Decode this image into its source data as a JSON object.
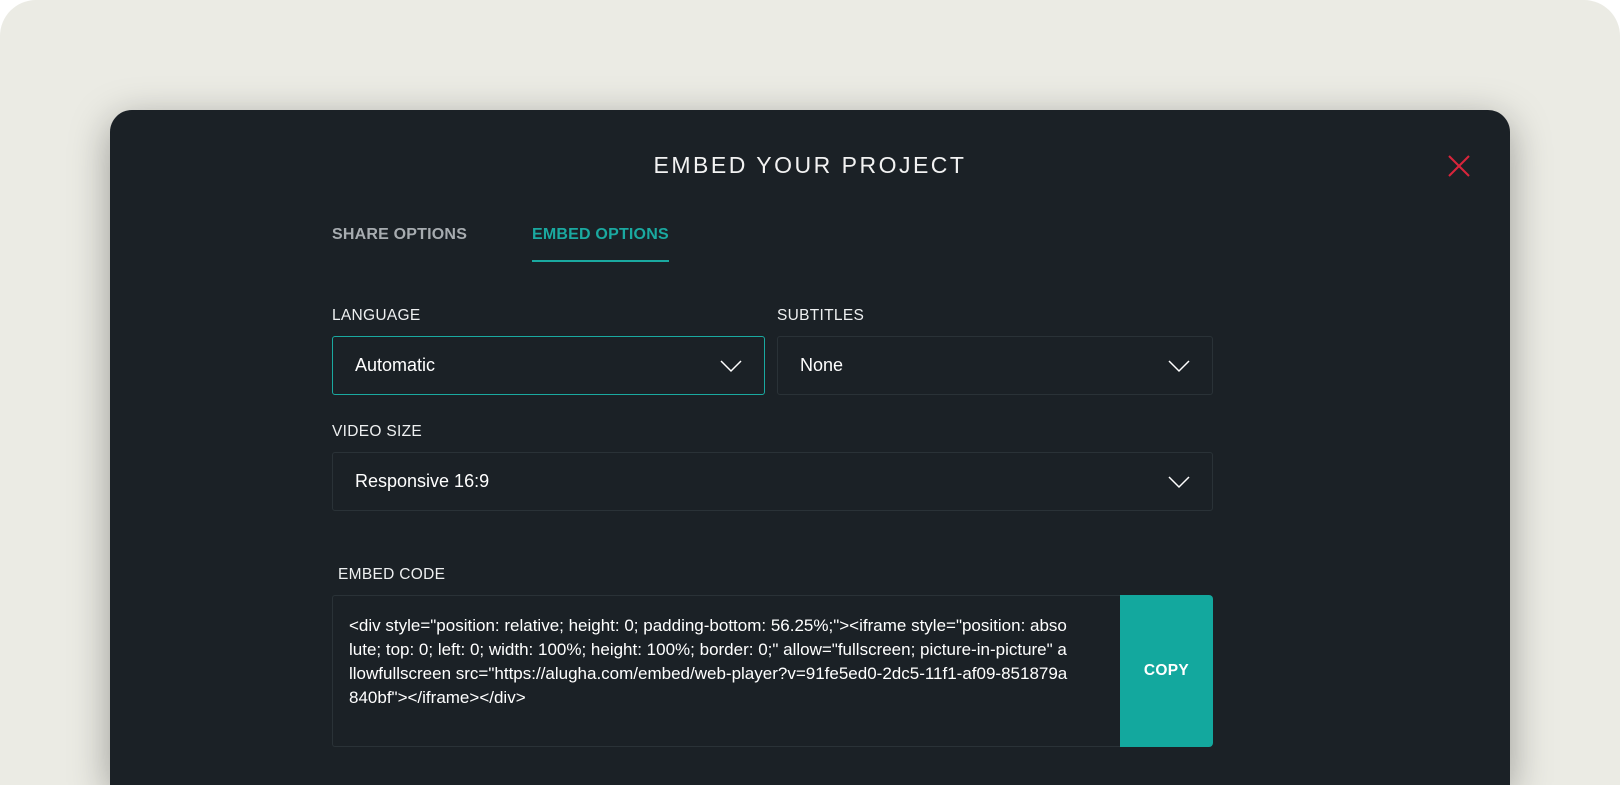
{
  "modal": {
    "title": "EMBED YOUR PROJECT",
    "close_icon": "close-icon",
    "accent_color": "#1aa9a0",
    "close_color": "#d9253b"
  },
  "tabs": [
    {
      "label": "SHARE OPTIONS",
      "active": false
    },
    {
      "label": "EMBED OPTIONS",
      "active": true
    }
  ],
  "form": {
    "language": {
      "label": "LANGUAGE",
      "value": "Automatic"
    },
    "subtitles": {
      "label": "SUBTITLES",
      "value": "None"
    },
    "video_size": {
      "label": "VIDEO SIZE",
      "value": "Responsive 16:9"
    },
    "dropdown_icon": "chevron-down-icon"
  },
  "embed": {
    "label": "EMBED CODE",
    "code": "<div style=\"position: relative; height: 0; padding-bottom: 56.25%;\"><iframe style=\"position: absolute; top: 0; left: 0; width: 100%; height: 100%; border: 0;\" allow=\"fullscreen; picture-in-picture\" allowfullscreen src=\"https://alugha.com/embed/web-player?v=91fe5ed0-2dc5-11f1-af09-851879a840bf\"></iframe></div>",
    "copy_label": "COPY"
  }
}
